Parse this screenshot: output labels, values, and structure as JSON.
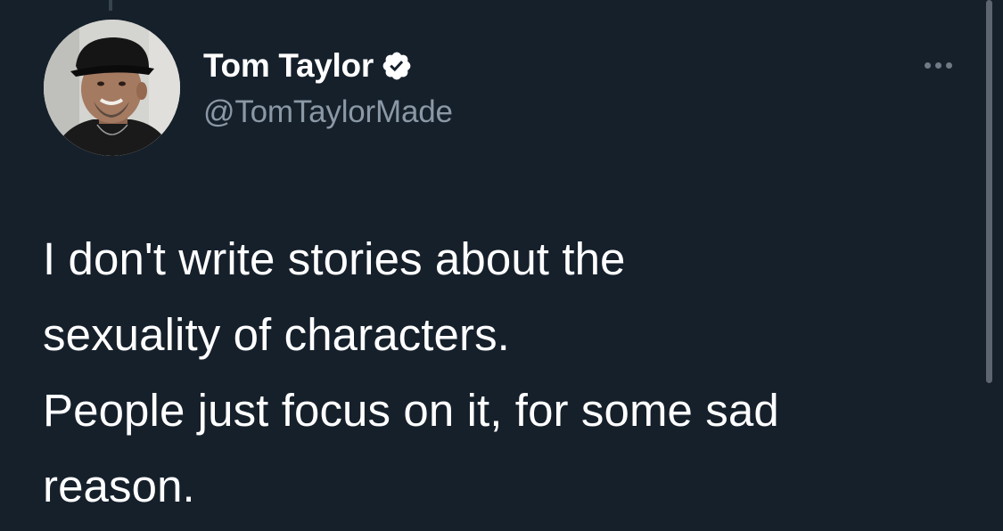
{
  "author": {
    "display_name": "Tom Taylor",
    "handle": "@TomTaylorMade",
    "verified": true,
    "avatar_icon": "profile-photo"
  },
  "menu": {
    "icon": "more-horizontal-icon"
  },
  "tweet": {
    "text_lines": [
      "I don't write stories about the",
      "sexuality of characters.",
      "People just focus on it, for some sad",
      "reason."
    ]
  },
  "colors": {
    "background": "#15202b",
    "primary_text": "#ffffff",
    "secondary_text": "#8b98a5",
    "verified_badge": "#ffffff"
  }
}
